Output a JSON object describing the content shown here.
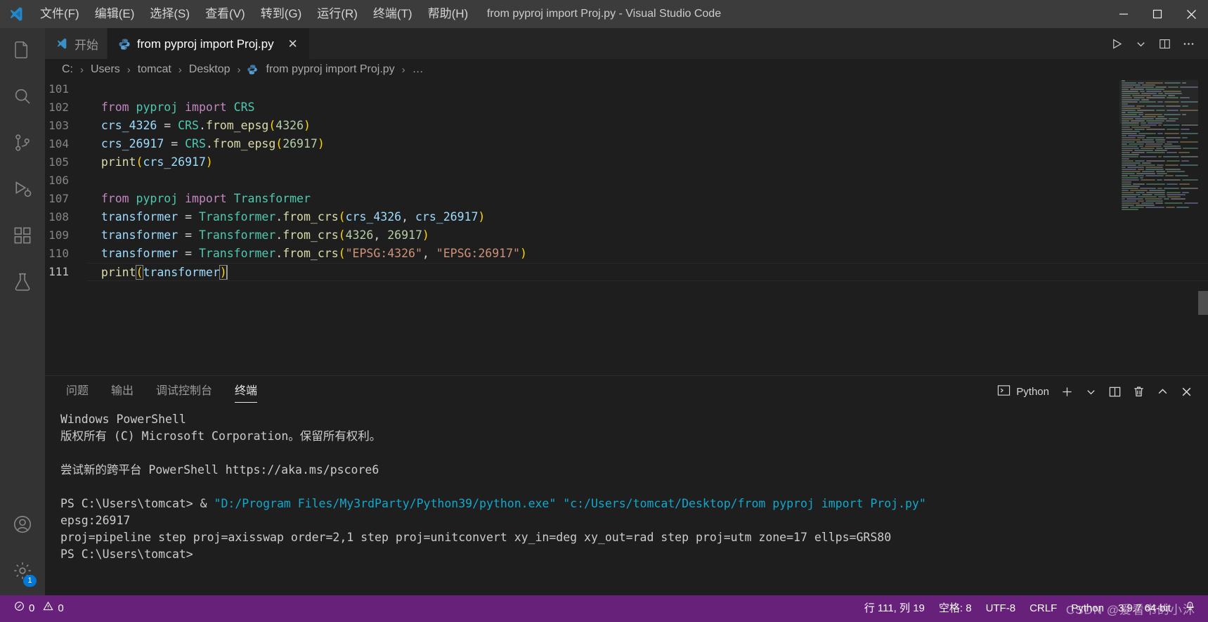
{
  "window": {
    "title": "from pyproj import Proj.py - Visual Studio Code",
    "minimize_label": "最小化",
    "maximize_label": "最大化",
    "close_label": "关闭"
  },
  "menubar": {
    "items": [
      {
        "label": "文件(F)",
        "name": "menu-file"
      },
      {
        "label": "编辑(E)",
        "name": "menu-edit"
      },
      {
        "label": "选择(S)",
        "name": "menu-selection"
      },
      {
        "label": "查看(V)",
        "name": "menu-view"
      },
      {
        "label": "转到(G)",
        "name": "menu-go"
      },
      {
        "label": "运行(R)",
        "name": "menu-run"
      },
      {
        "label": "终端(T)",
        "name": "menu-terminal"
      },
      {
        "label": "帮助(H)",
        "name": "menu-help"
      }
    ]
  },
  "activitybar": {
    "items": [
      {
        "icon": "files-icon",
        "name": "activity-explorer",
        "active": false
      },
      {
        "icon": "search-icon",
        "name": "activity-search",
        "active": false
      },
      {
        "icon": "source-control-icon",
        "name": "activity-source-control",
        "active": false
      },
      {
        "icon": "run-debug-icon",
        "name": "activity-run-debug",
        "active": false
      },
      {
        "icon": "extensions-icon",
        "name": "activity-extensions",
        "active": false
      },
      {
        "icon": "testing-icon",
        "name": "activity-testing",
        "active": false
      }
    ],
    "account_icon": "account-icon",
    "settings_icon": "gear-icon",
    "settings_badge": "1"
  },
  "tabs": {
    "items": [
      {
        "label": "开始",
        "icon": "vscode-icon",
        "active": false,
        "closable": false
      },
      {
        "label": "from pyproj import Proj.py",
        "icon": "python-icon",
        "active": true,
        "closable": true
      }
    ],
    "close_glyph": "✕",
    "actions": {
      "run_label": "运行 Python 文件",
      "run_dropdown_label": "运行选项",
      "split_label": "拆分编辑器",
      "more_label": "更多操作"
    }
  },
  "breadcrumb": {
    "items": [
      "C:",
      "Users",
      "tomcat",
      "Desktop",
      "from pyproj import Proj.py",
      "…"
    ],
    "separator": "›",
    "file_icon": "python-icon"
  },
  "editor": {
    "cursor_caret": "|",
    "lines": [
      {
        "no": "101",
        "tokens": [],
        "current": false
      },
      {
        "no": "102",
        "current": false,
        "tokens": [
          {
            "t": "from ",
            "c": "kw"
          },
          {
            "t": "pyproj ",
            "c": "mod"
          },
          {
            "t": "import ",
            "c": "kw"
          },
          {
            "t": "CRS",
            "c": "cls"
          }
        ]
      },
      {
        "no": "103",
        "current": false,
        "tokens": [
          {
            "t": "crs_4326",
            "c": "var"
          },
          {
            "t": " = ",
            "c": "op"
          },
          {
            "t": "CRS",
            "c": "cls"
          },
          {
            "t": ".",
            "c": "plain"
          },
          {
            "t": "from_epsg",
            "c": "fn"
          },
          {
            "t": "(",
            "c": "punc"
          },
          {
            "t": "4326",
            "c": "num"
          },
          {
            "t": ")",
            "c": "punc"
          }
        ]
      },
      {
        "no": "104",
        "current": false,
        "tokens": [
          {
            "t": "crs_26917",
            "c": "var"
          },
          {
            "t": " = ",
            "c": "op"
          },
          {
            "t": "CRS",
            "c": "cls"
          },
          {
            "t": ".",
            "c": "plain"
          },
          {
            "t": "from_epsg",
            "c": "fn"
          },
          {
            "t": "(",
            "c": "punc"
          },
          {
            "t": "26917",
            "c": "num"
          },
          {
            "t": ")",
            "c": "punc"
          }
        ]
      },
      {
        "no": "105",
        "current": false,
        "tokens": [
          {
            "t": "print",
            "c": "fn"
          },
          {
            "t": "(",
            "c": "punc"
          },
          {
            "t": "crs_26917",
            "c": "var"
          },
          {
            "t": ")",
            "c": "punc"
          }
        ]
      },
      {
        "no": "106",
        "current": false,
        "tokens": []
      },
      {
        "no": "107",
        "current": false,
        "tokens": [
          {
            "t": "from ",
            "c": "kw"
          },
          {
            "t": "pyproj ",
            "c": "mod"
          },
          {
            "t": "import ",
            "c": "kw"
          },
          {
            "t": "Transformer",
            "c": "cls"
          }
        ]
      },
      {
        "no": "108",
        "current": false,
        "tokens": [
          {
            "t": "transformer",
            "c": "var"
          },
          {
            "t": " = ",
            "c": "op"
          },
          {
            "t": "Transformer",
            "c": "cls"
          },
          {
            "t": ".",
            "c": "plain"
          },
          {
            "t": "from_crs",
            "c": "fn"
          },
          {
            "t": "(",
            "c": "punc"
          },
          {
            "t": "crs_4326",
            "c": "var"
          },
          {
            "t": ", ",
            "c": "plain"
          },
          {
            "t": "crs_26917",
            "c": "var"
          },
          {
            "t": ")",
            "c": "punc"
          }
        ]
      },
      {
        "no": "109",
        "current": false,
        "tokens": [
          {
            "t": "transformer",
            "c": "var"
          },
          {
            "t": " = ",
            "c": "op"
          },
          {
            "t": "Transformer",
            "c": "cls"
          },
          {
            "t": ".",
            "c": "plain"
          },
          {
            "t": "from_crs",
            "c": "fn"
          },
          {
            "t": "(",
            "c": "punc"
          },
          {
            "t": "4326",
            "c": "num"
          },
          {
            "t": ", ",
            "c": "plain"
          },
          {
            "t": "26917",
            "c": "num"
          },
          {
            "t": ")",
            "c": "punc"
          }
        ]
      },
      {
        "no": "110",
        "current": false,
        "tokens": [
          {
            "t": "transformer",
            "c": "var"
          },
          {
            "t": " = ",
            "c": "op"
          },
          {
            "t": "Transformer",
            "c": "cls"
          },
          {
            "t": ".",
            "c": "plain"
          },
          {
            "t": "from_crs",
            "c": "fn"
          },
          {
            "t": "(",
            "c": "punc"
          },
          {
            "t": "\"EPSG:4326\"",
            "c": "str"
          },
          {
            "t": ", ",
            "c": "plain"
          },
          {
            "t": "\"EPSG:26917\"",
            "c": "str"
          },
          {
            "t": ")",
            "c": "punc"
          }
        ]
      },
      {
        "no": "111",
        "current": true,
        "tokens": [
          {
            "t": "print",
            "c": "fn"
          },
          {
            "t": "(",
            "c": "punc bmatch"
          },
          {
            "t": "transformer",
            "c": "var"
          },
          {
            "t": ")",
            "c": "punc bmatch"
          }
        ]
      }
    ]
  },
  "panel": {
    "tabs": [
      {
        "label": "问题",
        "name": "panel-tab-problems",
        "active": false
      },
      {
        "label": "输出",
        "name": "panel-tab-output",
        "active": false
      },
      {
        "label": "调试控制台",
        "name": "panel-tab-debug-console",
        "active": false
      },
      {
        "label": "终端",
        "name": "panel-tab-terminal",
        "active": true
      }
    ],
    "terminal_name": "Python",
    "actions": {
      "new_terminal": "新建终端",
      "dropdown": "启动配置文件",
      "split": "拆分终端",
      "kill": "终止终端",
      "maximize": "最大化面板",
      "close": "关闭面板"
    }
  },
  "terminal": {
    "lines": [
      [
        {
          "t": "Windows PowerShell",
          "c": "t-white"
        }
      ],
      [
        {
          "t": "版权所有 (C) Microsoft Corporation。保留所有权利。",
          "c": "t-white"
        }
      ],
      [
        {
          "t": "",
          "c": "t-white"
        }
      ],
      [
        {
          "t": "尝试新的跨平台 PowerShell https://aka.ms/pscore6",
          "c": "t-white"
        }
      ],
      [
        {
          "t": "",
          "c": "t-white"
        }
      ],
      [
        {
          "t": "PS C:\\Users\\tomcat> & ",
          "c": "t-white"
        },
        {
          "t": "\"D:/Program Files/My3rdParty/Python39/python.exe\" \"c:/Users/tomcat/Desktop/from pyproj import Proj.py\"",
          "c": "t-cyan"
        }
      ],
      [
        {
          "t": "epsg:26917",
          "c": "t-white"
        }
      ],
      [
        {
          "t": "proj=pipeline step proj=axisswap order=2,1 step proj=unitconvert xy_in=deg xy_out=rad step proj=utm zone=17 ellps=GRS80",
          "c": "t-white"
        }
      ],
      [
        {
          "t": "PS C:\\Users\\tomcat>",
          "c": "t-white"
        }
      ]
    ]
  },
  "statusbar": {
    "errors": "0",
    "warnings": "0",
    "position": "行 111, 列 19",
    "indent": "空格: 8",
    "encoding": "UTF-8",
    "eol": "CRLF",
    "language": "Python",
    "interpreter": "3.9.7 64-bit",
    "watermark": "CSDN @爱看书的小沐",
    "remote_icon": "remote-icon",
    "bell_icon": "bell-icon"
  },
  "colors": {
    "accent": "#68217a",
    "titlebar": "#3c3c3c",
    "activitybar": "#333333",
    "editor_bg": "#1e1e1e",
    "tab_inactive": "#2d2d2d",
    "terminal_cyan": "#11a8cd"
  }
}
